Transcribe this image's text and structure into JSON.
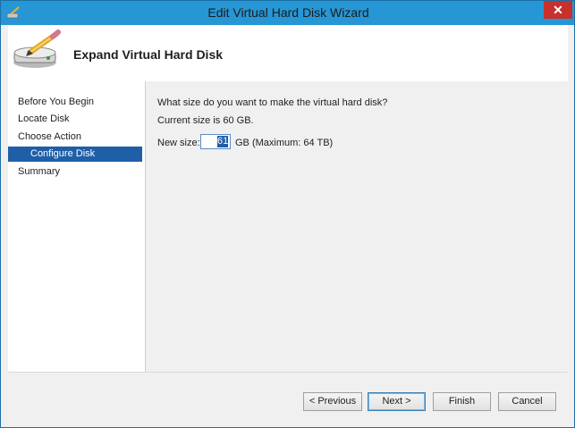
{
  "window": {
    "title": "Edit Virtual Hard Disk Wizard",
    "close_label": "✕"
  },
  "header": {
    "title": "Expand Virtual Hard Disk",
    "icon": "disk-pencil-icon"
  },
  "nav": {
    "items": [
      {
        "label": "Before You Begin",
        "active": false,
        "sub": false
      },
      {
        "label": "Locate Disk",
        "active": false,
        "sub": false
      },
      {
        "label": "Choose Action",
        "active": false,
        "sub": false
      },
      {
        "label": "Configure Disk",
        "active": true,
        "sub": true
      },
      {
        "label": "Summary",
        "active": false,
        "sub": false
      }
    ]
  },
  "content": {
    "question": "What size do you want to make the virtual hard disk?",
    "current_size": "Current size is 60 GB.",
    "new_size_label": "New size:",
    "new_size_value": "61",
    "new_size_unit": "GB (Maximum: 64 TB)"
  },
  "footer": {
    "previous_label": "< Previous",
    "next_label": "Next >",
    "finish_label": "Finish",
    "cancel_label": "Cancel"
  },
  "colors": {
    "titlebar": "#2796d5",
    "selection": "#1f5fa8",
    "close": "#c7302b"
  }
}
